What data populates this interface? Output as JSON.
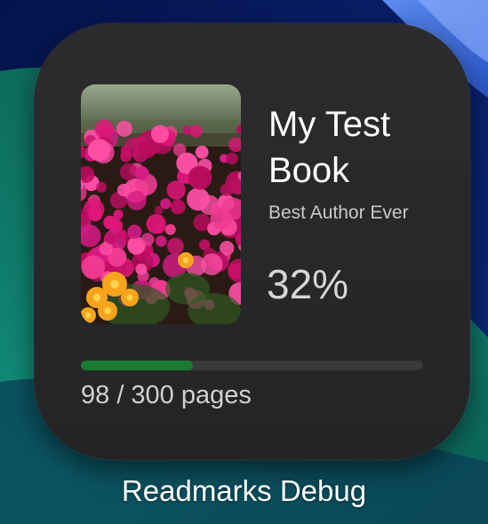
{
  "widget": {
    "book_title": "My Test Book",
    "author": "Best Author Ever",
    "percent_label": "32%",
    "progress_fraction": 0.3267,
    "pages_label": "98 / 300 pages",
    "cover_image": "flower-field-cover-image",
    "progress_color": "#1a7a32"
  },
  "home_screen": {
    "app_name": "Readmarks Debug"
  }
}
